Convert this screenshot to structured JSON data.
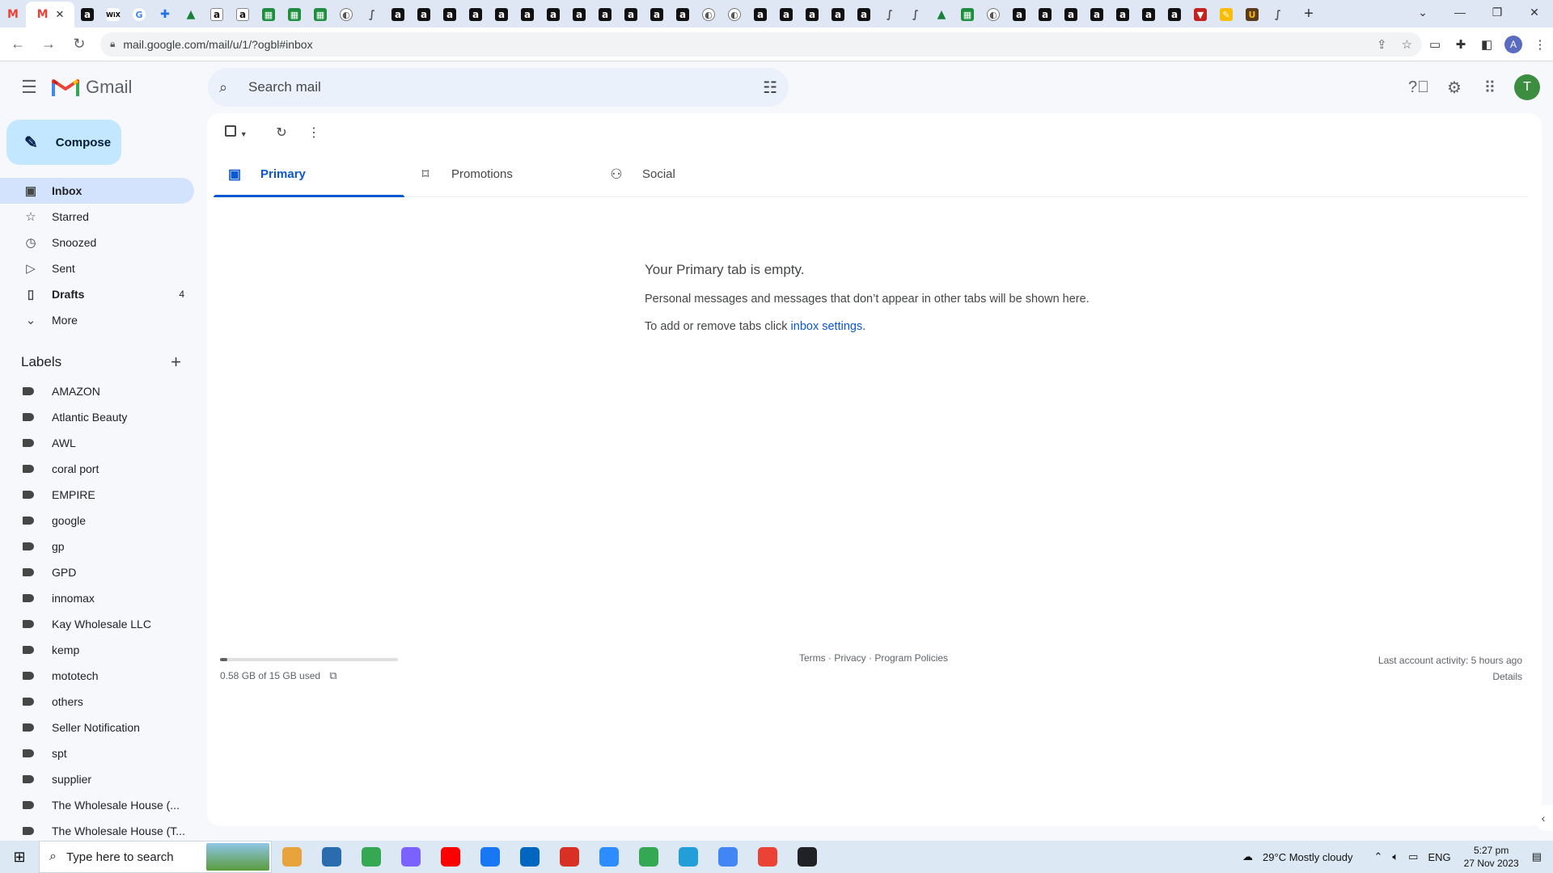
{
  "browser": {
    "active_tab_icon": "gmail-icon",
    "url": "mail.google.com/mail/u/1/?ogbl#inbox",
    "profile_initial": "A",
    "tab_favicons": [
      "amz",
      "wix",
      "g",
      "puz",
      "drive",
      "amz2",
      "amz2",
      "sheet",
      "sheet",
      "sheet",
      "globe",
      "abc",
      "amz",
      "amz",
      "amz",
      "amz",
      "amz",
      "amz",
      "amz",
      "amz",
      "amz",
      "amz",
      "amz",
      "amz",
      "globe",
      "globe",
      "amz",
      "amz",
      "amz",
      "amz",
      "amz",
      "abc",
      "abc",
      "drive",
      "sheet",
      "globe",
      "amz",
      "amz",
      "amz",
      "amz",
      "amz",
      "amz",
      "amz",
      "red",
      "pen",
      "ups",
      "abc"
    ],
    "tab_glyphs": {
      "amz": "a",
      "amz2": "a",
      "wix": "WiX",
      "g": "G",
      "puz": "✚",
      "drive": "▲",
      "sheet": "▦",
      "globe": "◐",
      "abc": "∫",
      "red": "▼",
      "pen": "✎",
      "ups": "U"
    }
  },
  "gmail": {
    "app_name": "Gmail",
    "search_placeholder": "Search mail",
    "avatar_initial": "T",
    "compose_label": "Compose",
    "nav": [
      {
        "label": "Inbox",
        "icon": "inbox-icon",
        "glyph": "▣",
        "active": true,
        "count": ""
      },
      {
        "label": "Starred",
        "icon": "star-icon",
        "glyph": "☆",
        "active": false,
        "count": ""
      },
      {
        "label": "Snoozed",
        "icon": "clock-icon",
        "glyph": "◷",
        "active": false,
        "count": ""
      },
      {
        "label": "Sent",
        "icon": "send-icon",
        "glyph": "▷",
        "active": false,
        "count": ""
      },
      {
        "label": "Drafts",
        "icon": "draft-icon",
        "glyph": "▯",
        "active": false,
        "bold": true,
        "count": "4"
      },
      {
        "label": "More",
        "icon": "chevron-down-icon",
        "glyph": "⌄",
        "active": false,
        "count": ""
      }
    ],
    "labels_title": "Labels",
    "labels": [
      "AMAZON",
      "Atlantic Beauty",
      "AWL",
      "coral port",
      "EMPIRE",
      "google",
      "gp",
      "GPD",
      "innomax",
      "Kay Wholesale LLC",
      "kemp",
      "mototech",
      "others",
      "Seller Notification",
      "spt",
      "supplier",
      "The Wholesale House (...",
      "The Wholesale House (T..."
    ],
    "tabs": [
      {
        "label": "Primary",
        "icon": "inbox-tab-icon",
        "glyph": "▣",
        "active": true
      },
      {
        "label": "Promotions",
        "icon": "tag-icon",
        "glyph": "⌑",
        "active": false
      },
      {
        "label": "Social",
        "icon": "people-icon",
        "glyph": "⚇",
        "active": false
      }
    ],
    "empty_title": "Your Primary tab is empty.",
    "empty_body": "Personal messages and messages that don’t appear in other tabs will be shown here.",
    "empty_settings_prefix": "To add or remove tabs click ",
    "empty_settings_link": "inbox settings",
    "empty_settings_suffix": ".",
    "storage_used_fraction": 0.039,
    "storage_text": "0.58 GB of 15 GB used",
    "footer_links": "Terms · Privacy · Program Policies",
    "last_activity": "Last account activity: 5 hours ago",
    "details_link": "Details"
  },
  "taskbar": {
    "search_placeholder": "Type here to search",
    "apps": [
      "#e8a33d",
      "#2b6cb0",
      "#34a853",
      "#7b61ff",
      "#ff0000",
      "#1877f2",
      "#0067c0",
      "#d93025",
      "#2d8cff",
      "#34a853",
      "#229ed9",
      "#4285f4",
      "#ea4335",
      "#202124"
    ],
    "weather": "29°C  Mostly cloudy",
    "lang": "ENG",
    "time": "5:27 pm",
    "date": "27 Nov 2023"
  },
  "colors": {
    "accent": "#0b57d0",
    "compose_bg": "#c2e7ff",
    "active_nav_bg": "#d3e3fd"
  }
}
